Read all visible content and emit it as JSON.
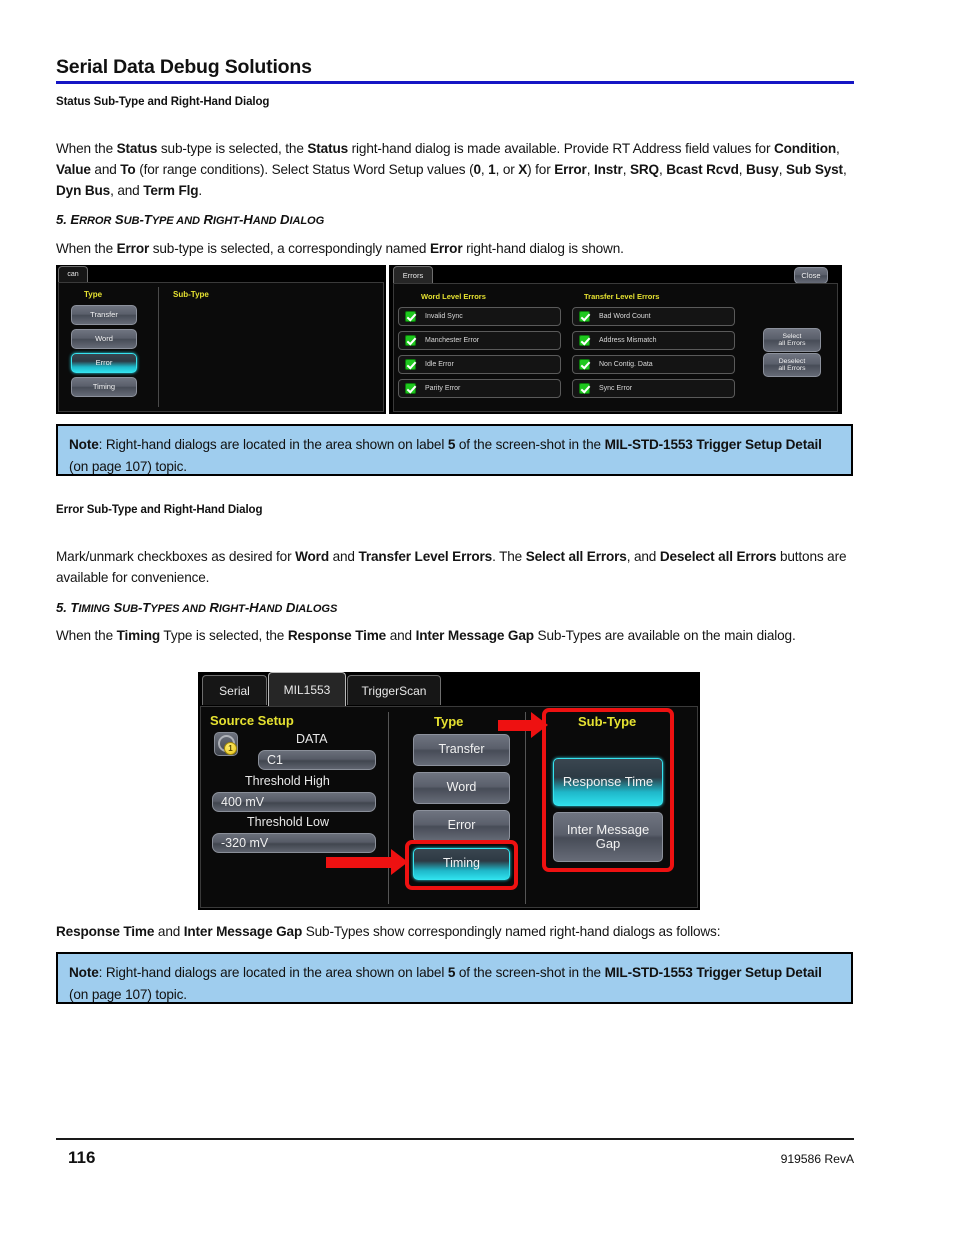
{
  "header": {
    "title": "Serial Data Debug Solutions",
    "rule_color": "#1515c4"
  },
  "captions": {
    "status_caption": "Status Sub-Type and Right-Hand Dialog",
    "error_caption": "Error Sub-Type and Right-Hand Dialog"
  },
  "paragraphs": {
    "status_para_html": "When the <b>Status</b> sub-type is selected, the <b>Status</b> right-hand dialog is made available. Provide RT Address field values for <b>Condition</b>, <b>Value</b> and <b>To</b> (for range conditions). Select Status Word Setup values (<b>0</b>, <b>1</b>, or <b>X</b>) for <b>Error</b>, <b>Instr</b>, <b>SRQ</b>, <b>Bcast Rcvd</b>, <b>Busy</b>, <b>Sub Syst</b>, <b>Dyn Bus</b>, and <b>Term Flg</b>.",
    "error_para_html": "When the <b>Error</b> sub-type is selected, a correspondingly named <b>Error</b> right-hand dialog is shown.",
    "mark_para_html": "Mark/unmark checkboxes as desired for <b>Word</b> and <b>Transfer Level Errors</b>. The <b>Select all Errors</b>, and <b>Deselect all Errors</b> buttons are available for convenience.",
    "timing_para_html": "When the <b>Timing</b> Type is selected, the <b>Response Time</b> and <b>Inter Message Gap</b> Sub-Types are available on the main dialog.",
    "subtypes_para_html": "<b>Response Time</b> and <b>Inter Message Gap</b> Sub-Types show correspondingly named right-hand dialogs as follows:"
  },
  "headings": {
    "error_heading_num": "5. ",
    "error_heading_html": "E<span class=\"sc\">RROR</span> S<span class=\"sc\">UB</span>-T<span class=\"sc\">YPE AND</span> R<span class=\"sc\">IGHT</span>-H<span class=\"sc\">AND</span> D<span class=\"sc\">IALOG</span>",
    "timing_heading_num": "5. ",
    "timing_heading_html": "T<span class=\"sc\">IMING</span> S<span class=\"sc\">UB</span>-T<span class=\"sc\">YPES AND</span> R<span class=\"sc\">IGHT</span>-H<span class=\"sc\">AND</span> D<span class=\"sc\">IALOGS</span>"
  },
  "notes": {
    "note1_html": "<b>Note</b>: Right-hand dialogs are located in the area shown on label <b>5</b> of the screen-shot in the <b>MIL-STD-1553 Trigger Setup Detail</b> (on page 107) topic.",
    "note2_html": "<b>Note</b>: Right-hand dialogs are located in the area shown on label <b>5</b> of the screen-shot in the <b>MIL-STD-1553 Trigger Setup Detail</b> (on page 107) topic.",
    "background": "#9fcdee"
  },
  "screenshot_error": {
    "left_panel": {
      "tab_label": "can",
      "type_label": "Type",
      "subtype_label": "Sub-Type",
      "type_buttons": [
        {
          "label": "Transfer",
          "selected": false
        },
        {
          "label": "Word",
          "selected": false
        },
        {
          "label": "Error",
          "selected": true
        },
        {
          "label": "Timing",
          "selected": false
        }
      ]
    },
    "right_panel": {
      "tab_label": "Errors",
      "close_label": "Close",
      "word_level_label": "Word Level Errors",
      "transfer_level_label": "Transfer Level Errors",
      "word_level_errors": [
        {
          "label": "Invalid Sync",
          "checked": true
        },
        {
          "label": "Manchester Error",
          "checked": true
        },
        {
          "label": "Idle Error",
          "checked": true
        },
        {
          "label": "Parity Error",
          "checked": true
        }
      ],
      "transfer_level_errors": [
        {
          "label": "Bad Word Count",
          "checked": true
        },
        {
          "label": "Address Mismatch",
          "checked": true
        },
        {
          "label": "Non Contig. Data",
          "checked": true
        },
        {
          "label": "Sync Error",
          "checked": true
        }
      ],
      "select_all_label": "Select\nall Errors",
      "select_all_line1": "Select",
      "select_all_line2": "all Errors",
      "deselect_all_line1": "Deselect",
      "deselect_all_line2": "all Errors"
    }
  },
  "screenshot_timing": {
    "tabs": [
      {
        "label": "Serial",
        "active": false
      },
      {
        "label": "MIL1553",
        "active": true
      },
      {
        "label": "TriggerScan",
        "active": false
      }
    ],
    "source_setup": {
      "title": "Source Setup",
      "data_label": "DATA",
      "channel_value": "C1",
      "probe_badge": "1",
      "threshold_high_label": "Threshold High",
      "threshold_high_value": "400 mV",
      "threshold_low_label": "Threshold Low",
      "threshold_low_value": "-320 mV"
    },
    "type": {
      "title": "Type",
      "buttons": [
        {
          "label": "Transfer",
          "selected": false
        },
        {
          "label": "Word",
          "selected": false
        },
        {
          "label": "Error",
          "selected": false
        },
        {
          "label": "Timing",
          "selected": true
        }
      ]
    },
    "subtype": {
      "title": "Sub-Type",
      "buttons": [
        {
          "label": "Response Time",
          "selected": true
        },
        {
          "label": "Inter Message Gap",
          "line1": "Inter Message",
          "line2": "Gap",
          "selected": false
        }
      ]
    },
    "callout_color": "#ee1111"
  },
  "footer": {
    "page_number": "116",
    "doc_id": "919586 RevA"
  }
}
